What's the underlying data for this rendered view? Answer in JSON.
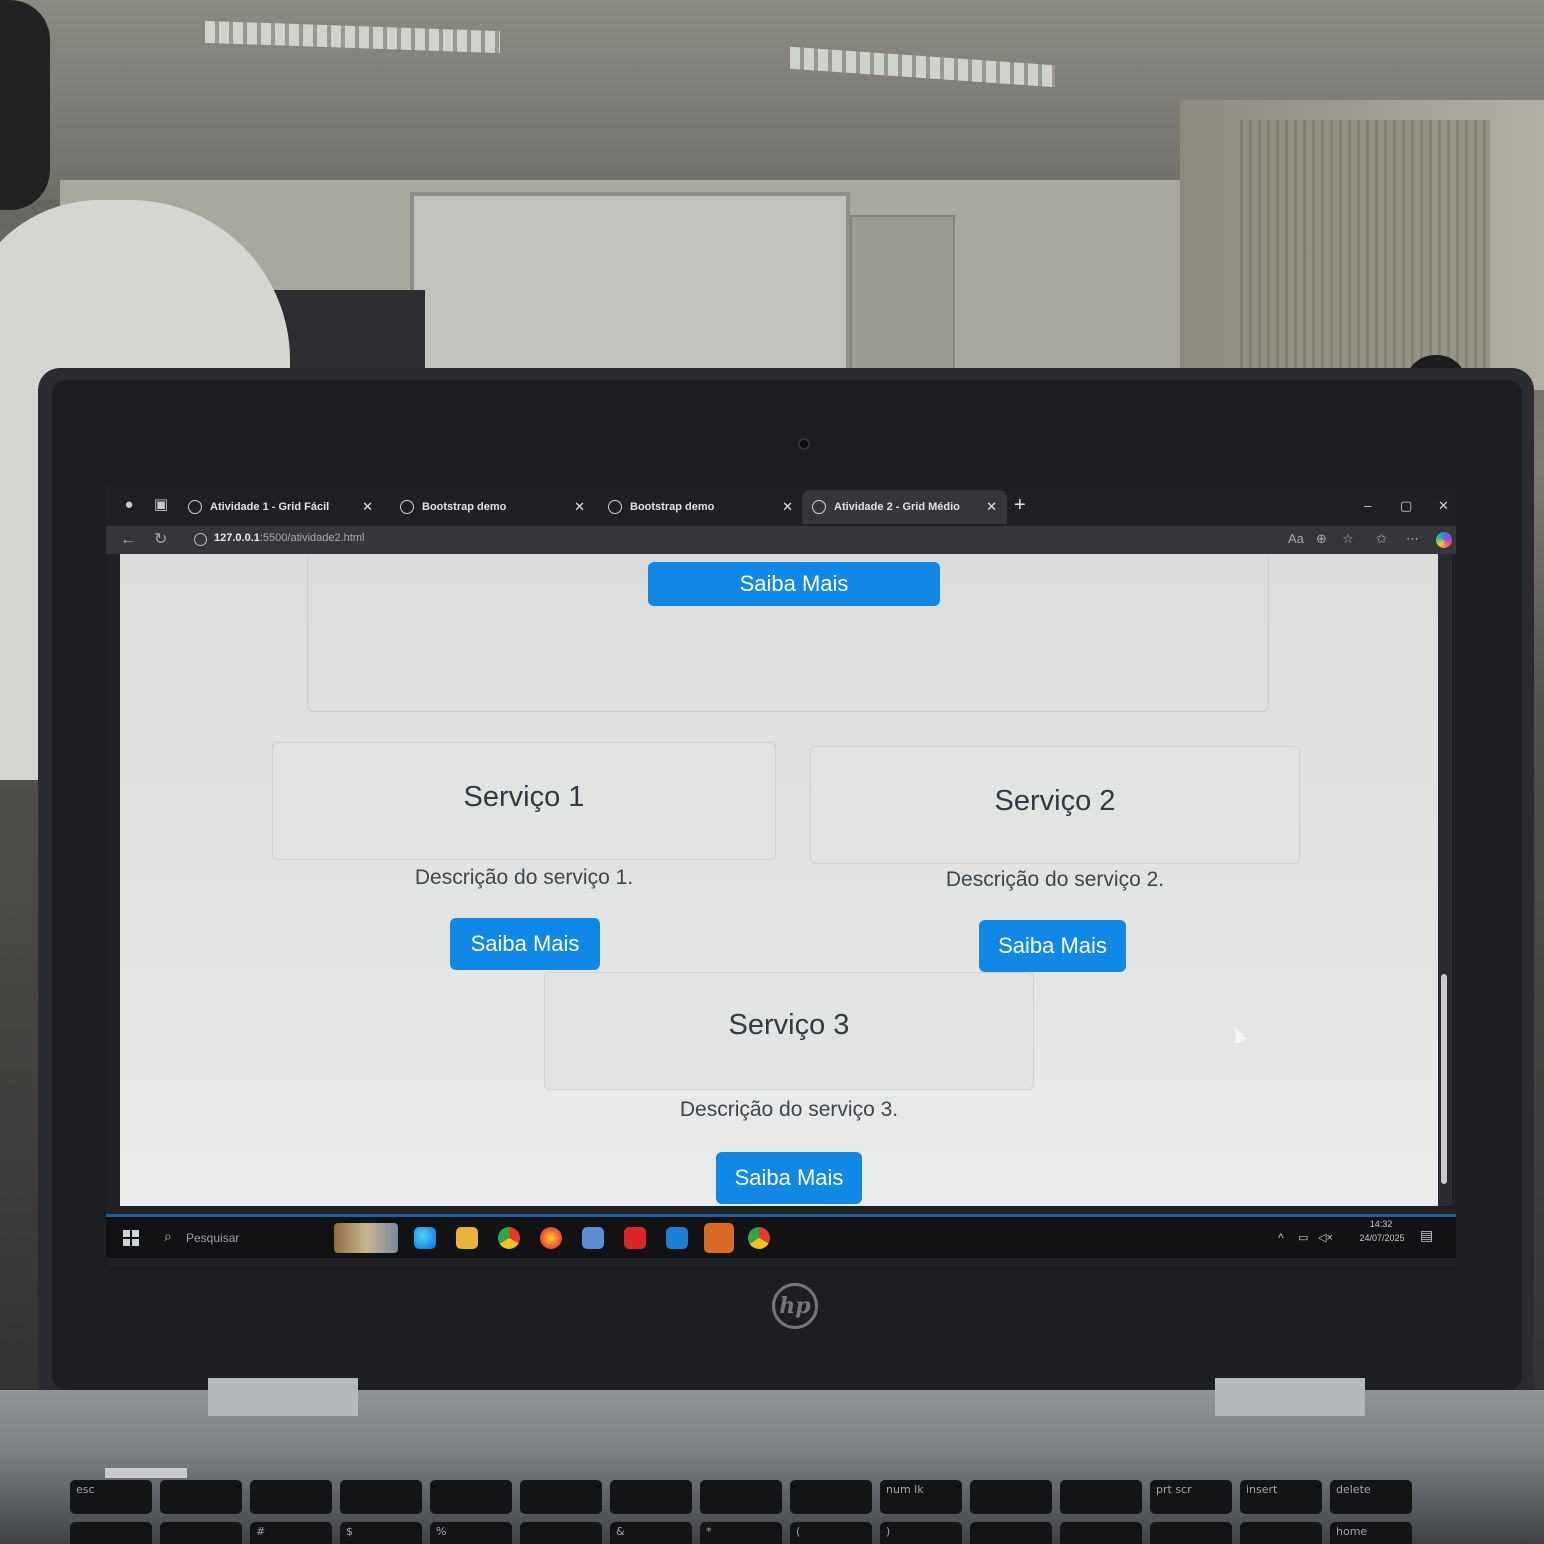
{
  "browser": {
    "tabs": [
      {
        "title": "Atividade 1 - Grid Fácil",
        "active": false
      },
      {
        "title": "Bootstrap demo",
        "active": false
      },
      {
        "title": "Bootstrap demo",
        "active": false
      },
      {
        "title": "Atividade 2 - Grid Médio",
        "active": true
      }
    ],
    "new_tab_glyph": "+",
    "window_controls": {
      "minimize": "–",
      "maximize": "▢",
      "close": "✕"
    },
    "url_host": "127.0.0.1",
    "url_path": ":5500/atividade2.html"
  },
  "page": {
    "top_button": "Saiba Mais",
    "services": [
      {
        "title": "Serviço 1",
        "description": "Descrição do serviço 1.",
        "button": "Saiba Mais"
      },
      {
        "title": "Serviço 2",
        "description": "Descrição do serviço 2.",
        "button": "Saiba Mais"
      },
      {
        "title": "Serviço 3",
        "description": "Descrição do serviço 3.",
        "button": "Saiba Mais"
      }
    ],
    "button_color": "#1188e6"
  },
  "taskbar": {
    "search_placeholder": "Pesquisar",
    "time": "14:32",
    "date": "24/07/2025",
    "apps": [
      "edge-icon",
      "file-explorer-icon",
      "chrome-icon",
      "firefox-icon",
      "notepad-icon",
      "wps-office-icon",
      "vscode-icon",
      "postgres-icon",
      "chrome-alt-icon"
    ]
  },
  "laptop": {
    "brand": "hp",
    "keys_row1": [
      "esc",
      "",
      "",
      "",
      "",
      "",
      "",
      "",
      "",
      "num lk",
      "",
      "",
      "prt scr",
      "insert",
      "delete"
    ],
    "keys_row2": [
      "",
      "",
      "#",
      "$",
      "%",
      "",
      "&",
      "*",
      "(",
      ")",
      "",
      "",
      "",
      "",
      "home"
    ]
  }
}
